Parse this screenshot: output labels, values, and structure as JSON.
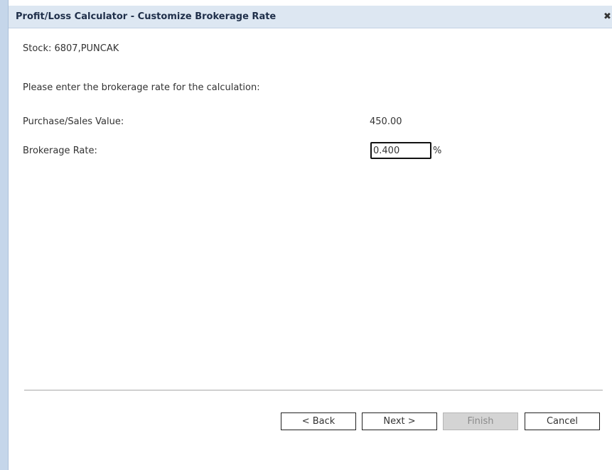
{
  "dialog": {
    "title": "Profit/Loss Calculator - Customize Brokerage Rate",
    "close_icon": "close-icon"
  },
  "stock": {
    "label": "Stock: 6807,PUNCAK"
  },
  "instruction": "Please enter the brokerage rate for the calculation:",
  "fields": {
    "purchase_sales": {
      "label": "Purchase/Sales Value:",
      "value": "450.00"
    },
    "brokerage": {
      "label": "Brokerage Rate:",
      "value": "0.400",
      "unit": "%"
    }
  },
  "buttons": {
    "back": "< Back",
    "next": "Next >",
    "finish": "Finish",
    "cancel": "Cancel"
  },
  "colors": {
    "titlebar": "#dde7f2",
    "left_edge": "#c5d6ea",
    "disabled_button": "#d4d4d4"
  }
}
